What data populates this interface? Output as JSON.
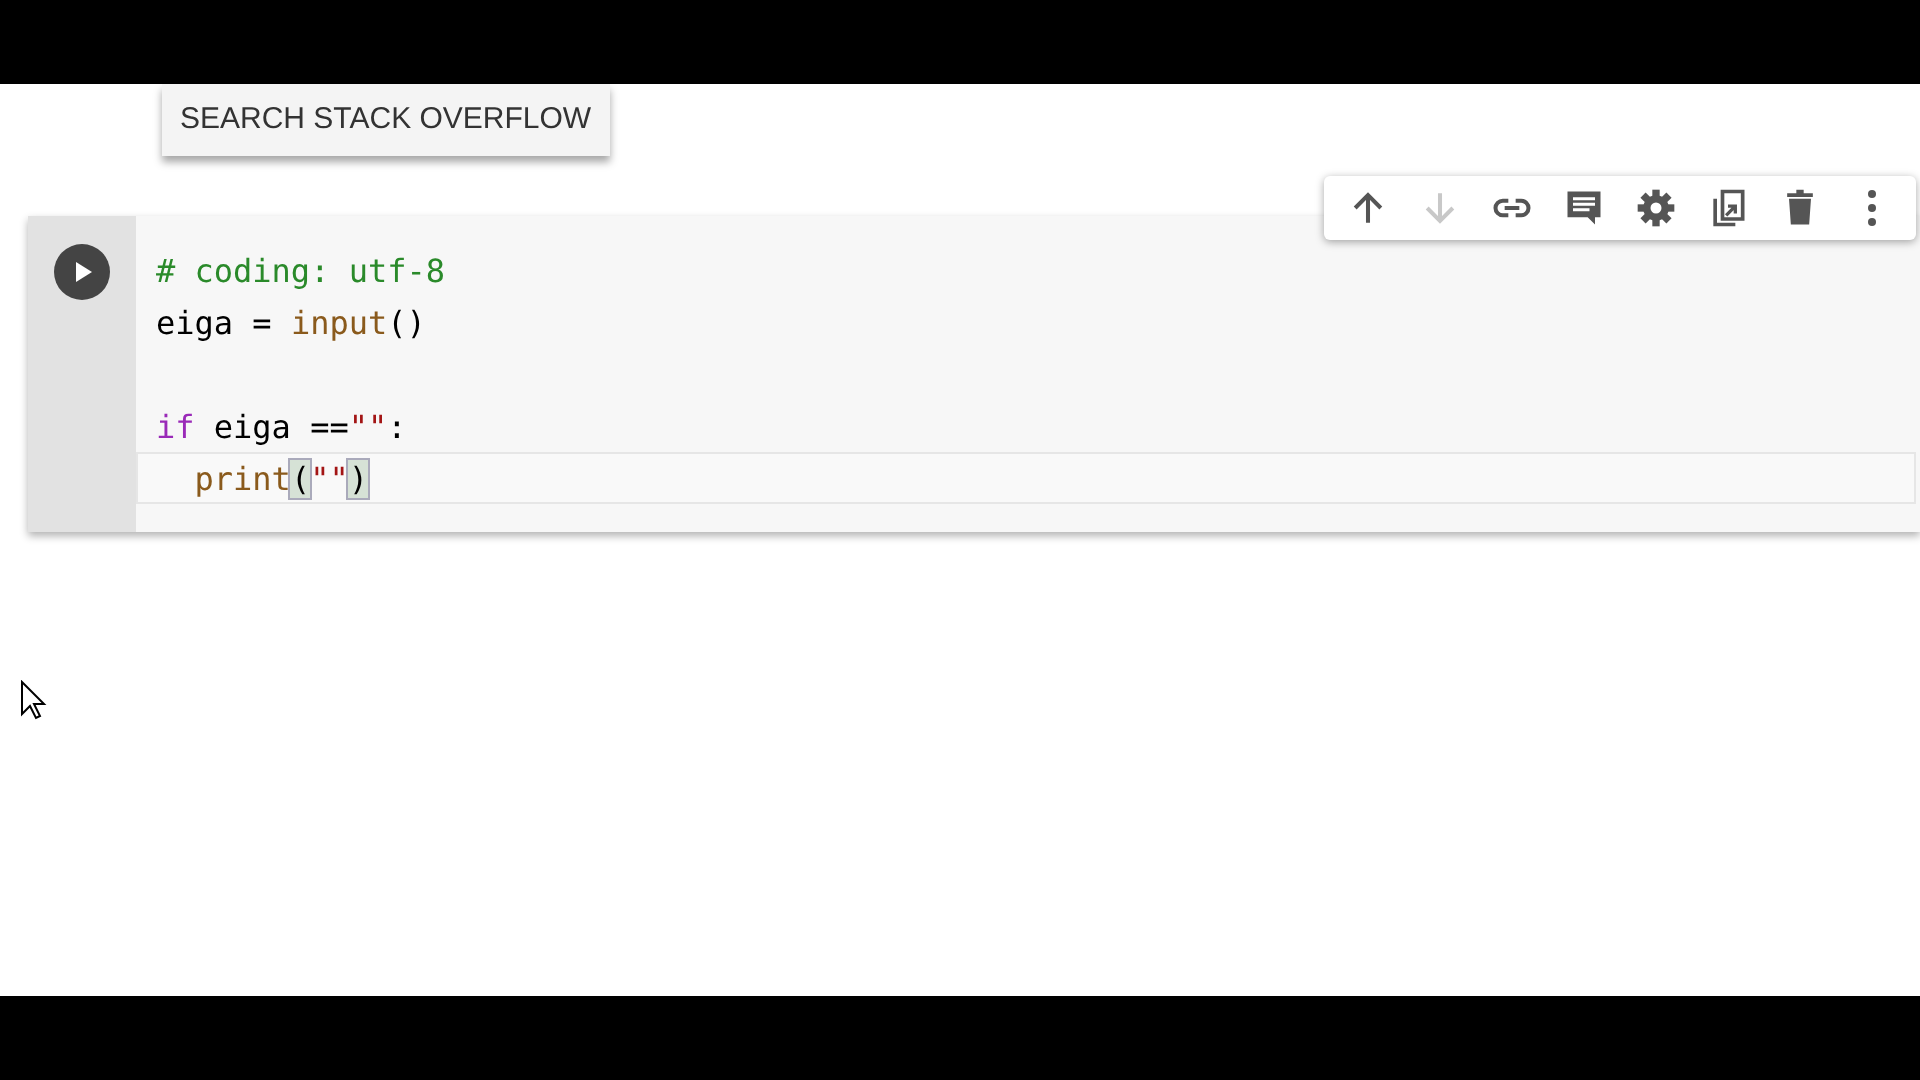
{
  "popup_button": {
    "label": "SEARCH STACK OVERFLOW"
  },
  "cell_toolbar": [
    {
      "kind": "up",
      "disabled": false
    },
    {
      "kind": "down",
      "disabled": true
    },
    {
      "kind": "link",
      "disabled": false
    },
    {
      "kind": "comment",
      "disabled": false
    },
    {
      "kind": "settings",
      "disabled": false
    },
    {
      "kind": "mirror",
      "disabled": false
    },
    {
      "kind": "delete",
      "disabled": false
    },
    {
      "kind": "more",
      "disabled": false
    }
  ],
  "code_cell": {
    "lines": [
      {
        "current": false,
        "tokens": [
          {
            "text": "# coding: utf-8",
            "kind": "comment"
          }
        ]
      },
      {
        "current": false,
        "tokens": [
          {
            "text": "eiga = ",
            "kind": "plain"
          },
          {
            "text": "input",
            "kind": "builtin"
          },
          {
            "text": "()",
            "kind": "plain"
          }
        ]
      },
      {
        "current": false
      },
      {
        "current": false,
        "tokens": [
          {
            "text": "if",
            "kind": "keyword"
          },
          {
            "text": " eiga ==",
            "kind": "plain"
          },
          {
            "text": "\"\"",
            "kind": "string"
          },
          {
            "text": ":",
            "kind": "plain"
          }
        ]
      },
      {
        "current": true,
        "tokens": [
          {
            "text": "  print",
            "kind": "builtin"
          },
          {
            "text": "(",
            "kind": "matched-bracket"
          },
          {
            "text": "\"\"",
            "kind": "string"
          },
          {
            "text": ")",
            "kind": "matched-bracket"
          }
        ]
      }
    ]
  }
}
